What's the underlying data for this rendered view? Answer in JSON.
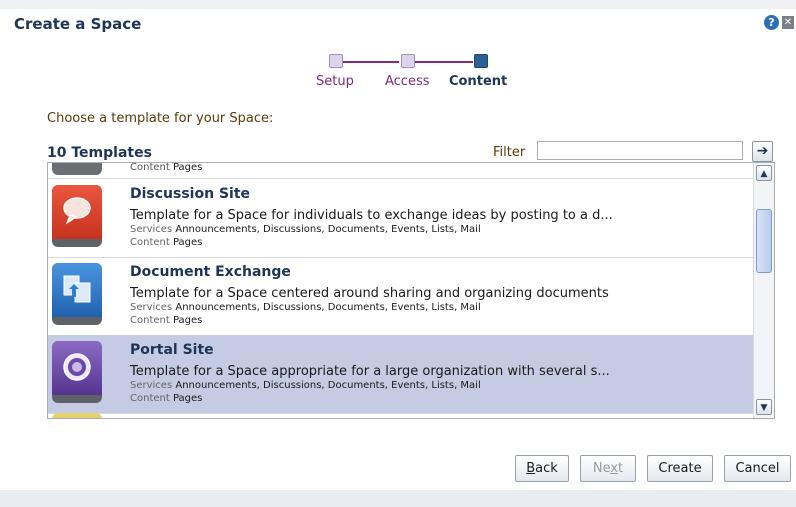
{
  "dialog": {
    "title": "Create a Space"
  },
  "icons": {
    "help": "help-icon",
    "close": "close-icon"
  },
  "train": {
    "stops": [
      {
        "label": "Setup",
        "state": "visited"
      },
      {
        "label": "Access",
        "state": "visited"
      },
      {
        "label": "Content",
        "state": "current"
      }
    ]
  },
  "prompt": "Choose a template for your Space:",
  "templates": {
    "count_label": "10 Templates",
    "filter_label": "Filter",
    "filter_value": "",
    "partial_top": {
      "content_label": "Content",
      "content_value": "Pages"
    },
    "items": [
      {
        "name": "Discussion Site",
        "description": "Template for a Space for individuals to exchange ideas by posting to a d...",
        "services_label": "Services",
        "services": "Announcements, Discussions, Documents, Events, Lists, Mail",
        "content_label": "Content",
        "content": "Pages",
        "icon": "speech-bubble-icon",
        "color": "#d9442d",
        "selected": false
      },
      {
        "name": "Document Exchange",
        "description": "Template for a Space centered around sharing and organizing documents",
        "services_label": "Services",
        "services": "Announcements, Discussions, Documents, Events, Lists, Mail",
        "content_label": "Content",
        "content": "Pages",
        "icon": "document-exchange-icon",
        "color": "#2f7fd0",
        "selected": false
      },
      {
        "name": "Portal Site",
        "description": "Template for a Space appropriate for a large organization with several s...",
        "services_label": "Services",
        "services": "Announcements, Discussions, Documents, Events, Lists, Mail",
        "content_label": "Content",
        "content": "Pages",
        "icon": "portal-icon",
        "color": "#6a4aa8",
        "selected": true
      }
    ]
  },
  "buttons": {
    "back_prefix": "",
    "back_underline": "B",
    "back_rest": "ack",
    "next_prefix": "Ne",
    "next_underline": "x",
    "next_rest": "t",
    "create": "Create",
    "cancel": "Cancel"
  },
  "colors": {
    "accent": "#1d3557",
    "train": "#7f2a7e",
    "selection": "#c4cbe2"
  }
}
